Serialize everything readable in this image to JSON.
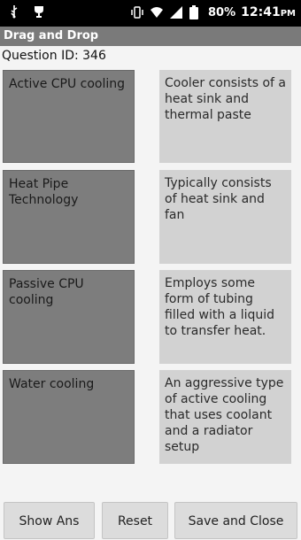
{
  "statusbar": {
    "battery_pct": "80%",
    "time": "12:41",
    "ampm": "PM"
  },
  "title": "Drag and Drop",
  "question": "Question ID: 346",
  "left_items": [
    {
      "label": "Active CPU cooling"
    },
    {
      "label": "Heat Pipe Technology"
    },
    {
      "label": "Passive CPU cooling"
    },
    {
      "label": "Water cooling"
    }
  ],
  "right_items": [
    {
      "label": "Cooler consists of a heat sink and thermal paste"
    },
    {
      "label": "Typically consists of heat sink and fan"
    },
    {
      "label": "Employs some form of tubing filled with a liquid to transfer heat."
    },
    {
      "label": "An aggressive type of active cooling that uses coolant and  a radiator setup"
    }
  ],
  "buttons": {
    "show_ans": "Show Ans",
    "reset": "Reset",
    "save_close": "Save and Close"
  }
}
